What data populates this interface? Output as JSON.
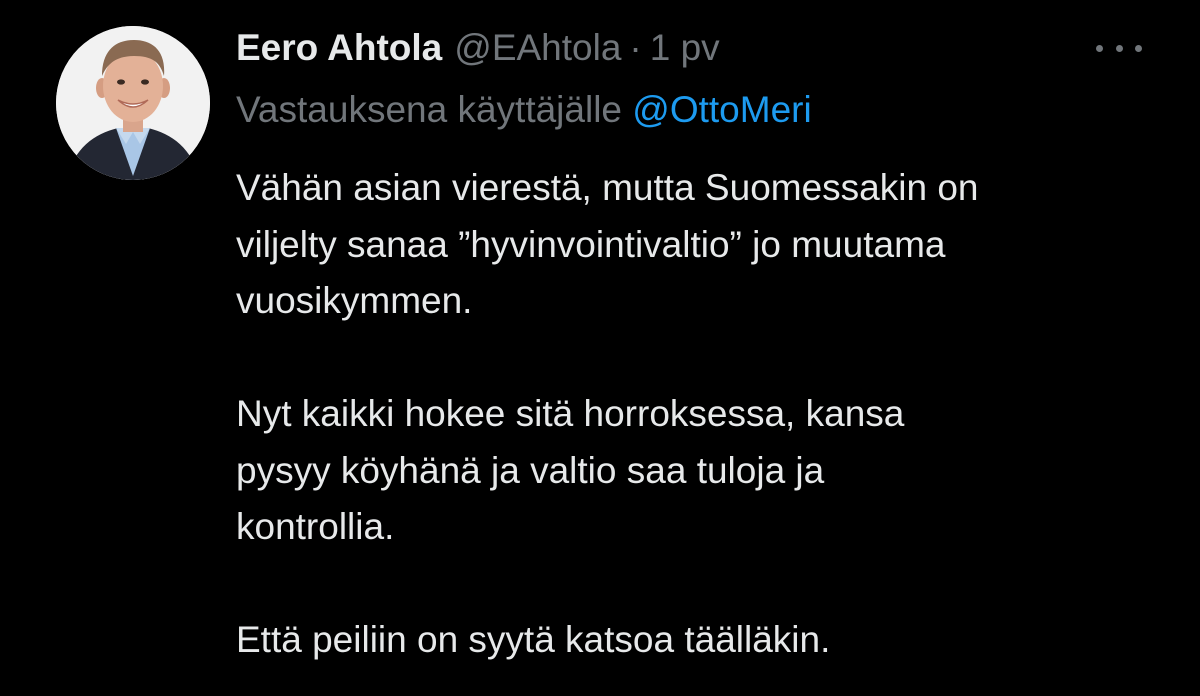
{
  "tweet": {
    "author": {
      "display_name": "Eero Ahtola",
      "handle": "@EAhtola",
      "avatar_icon": "profile-photo"
    },
    "separator": "·",
    "timestamp": "1 pv",
    "more_icon": "ellipsis-icon",
    "reply_context": {
      "prefix": "Vastauksena käyttäjälle",
      "mention": "@OttoMeri"
    },
    "paragraphs": [
      {
        "lines": [
          "Vähän asian vierestä, mutta Suomessakin on",
          "viljelty sanaa ”hyvinvointivaltio” jo muutama",
          "vuosikymmen."
        ]
      },
      {
        "lines": [
          "Nyt kaikki hokee sitä horroksessa, kansa",
          "pysyy köyhänä ja valtio saa tuloja ja",
          "kontrollia."
        ]
      },
      {
        "lines": [
          "Että peiliin on syytä katsoa täälläkin."
        ]
      }
    ]
  },
  "colors": {
    "background": "#000000",
    "primary_text": "#e7e9ea",
    "secondary_text": "#71767b",
    "accent": "#1d9bf0"
  }
}
